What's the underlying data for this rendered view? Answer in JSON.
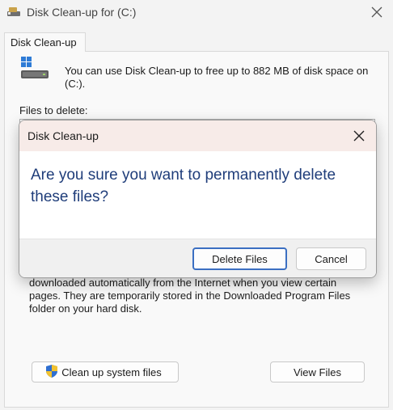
{
  "window": {
    "title": "Disk Clean-up for  (C:)",
    "close_icon": "close-icon"
  },
  "tab": {
    "label": "Disk Clean-up"
  },
  "main": {
    "intro": "You can use Disk Clean-up to free up to 882 MB of disk space on (C:).",
    "files_label": "Files to delete:",
    "description": "downloaded automatically from the Internet when you view certain pages. They are temporarily stored in the Downloaded Program Files folder on your hard disk.",
    "cleanup_system_label": "Clean up system files",
    "view_files_label": "View Files"
  },
  "dialog": {
    "title": "Disk Clean-up",
    "message": "Are you sure you want to permanently delete these files?",
    "delete_label": "Delete Files",
    "cancel_label": "Cancel"
  },
  "colors": {
    "accent": "#3b6fc2",
    "message_text": "#1f3d7a",
    "dialog_titlebar": "#f7ebe8"
  }
}
